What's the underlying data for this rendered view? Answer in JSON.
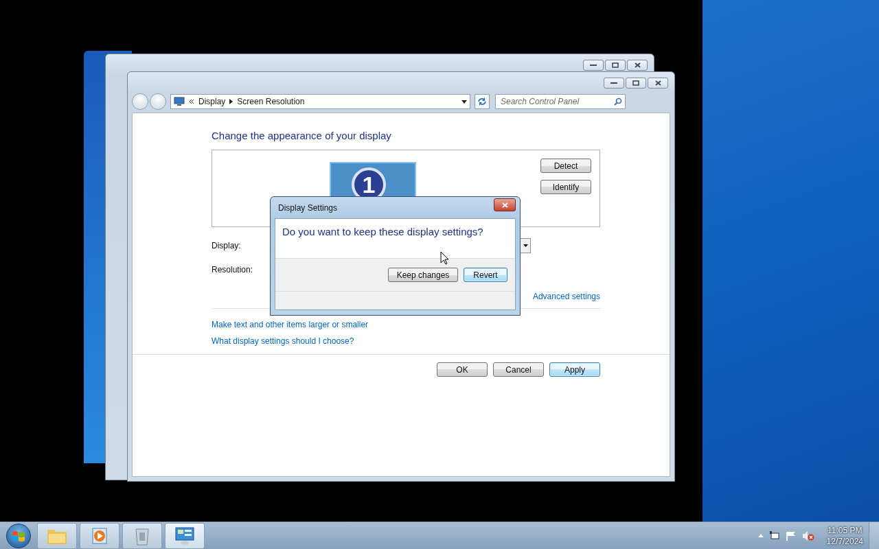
{
  "main_window": {
    "address_bar": {
      "crumbs": [
        "Display",
        "Screen Resolution"
      ]
    },
    "search": {
      "placeholder": "Search Control Panel"
    },
    "heading": "Change the appearance of your display",
    "monitor": {
      "number": "1"
    },
    "monitor_buttons": [
      "Detect",
      "Identify"
    ],
    "fields": [
      {
        "label": "Display:"
      },
      {
        "label": "Resolution:"
      }
    ],
    "advanced_link": "Advanced settings",
    "links": [
      "Make text and other items larger or smaller",
      "What display settings should I choose?"
    ],
    "buttons": [
      {
        "label": "OK",
        "default": false
      },
      {
        "label": "Cancel",
        "default": false
      },
      {
        "label": "Apply",
        "default": true
      }
    ]
  },
  "dialog": {
    "title": "Display Settings",
    "question": "Do you want to keep these display settings?",
    "buttons": [
      {
        "label": "Keep changes",
        "default": false
      },
      {
        "label": "Revert",
        "default": true
      }
    ]
  },
  "taskbar": {
    "items": [
      {
        "kind": "folder",
        "selected": false
      },
      {
        "kind": "media",
        "selected": false
      },
      {
        "kind": "bin",
        "selected": false
      },
      {
        "kind": "panel",
        "selected": true
      }
    ],
    "clock": {
      "time": "11:05 PM",
      "date": "12/7/2024"
    }
  }
}
